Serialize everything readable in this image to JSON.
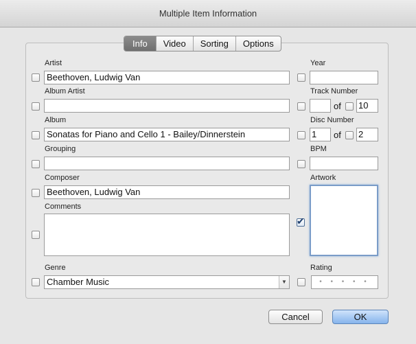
{
  "window": {
    "title": "Multiple Item Information"
  },
  "tabs": [
    {
      "label": "Info",
      "active": true
    },
    {
      "label": "Video",
      "active": false
    },
    {
      "label": "Sorting",
      "active": false
    },
    {
      "label": "Options",
      "active": false
    }
  ],
  "fields": {
    "artist": {
      "label": "Artist",
      "value": "Beethoven, Ludwig Van",
      "checked": false
    },
    "album_artist": {
      "label": "Album Artist",
      "value": "",
      "checked": false
    },
    "album": {
      "label": "Album",
      "value": "Sonatas for Piano and Cello 1 - Bailey/Dinnerstein",
      "checked": false
    },
    "grouping": {
      "label": "Grouping",
      "value": "",
      "checked": false
    },
    "composer": {
      "label": "Composer",
      "value": "Beethoven, Ludwig Van",
      "checked": false
    },
    "comments": {
      "label": "Comments",
      "value": "",
      "checked": false
    },
    "genre": {
      "label": "Genre",
      "value": "Chamber Music",
      "checked": false
    },
    "year": {
      "label": "Year",
      "value": "",
      "checked": false
    },
    "track_number": {
      "label": "Track Number",
      "value": "",
      "of_label": "of",
      "total": "10"
    },
    "disc_number": {
      "label": "Disc Number",
      "value": "1",
      "of_label": "of",
      "total": "2"
    },
    "bpm": {
      "label": "BPM",
      "value": "",
      "checked": false
    },
    "artwork": {
      "label": "Artwork",
      "checked": true,
      "check_glyph": "✔"
    },
    "rating": {
      "label": "Rating",
      "dots": "• • • • •",
      "checked": false
    }
  },
  "buttons": {
    "cancel": "Cancel",
    "ok": "OK"
  },
  "colors": {
    "accent": "#86b4ec",
    "tab_active": "#7a7a7a"
  }
}
